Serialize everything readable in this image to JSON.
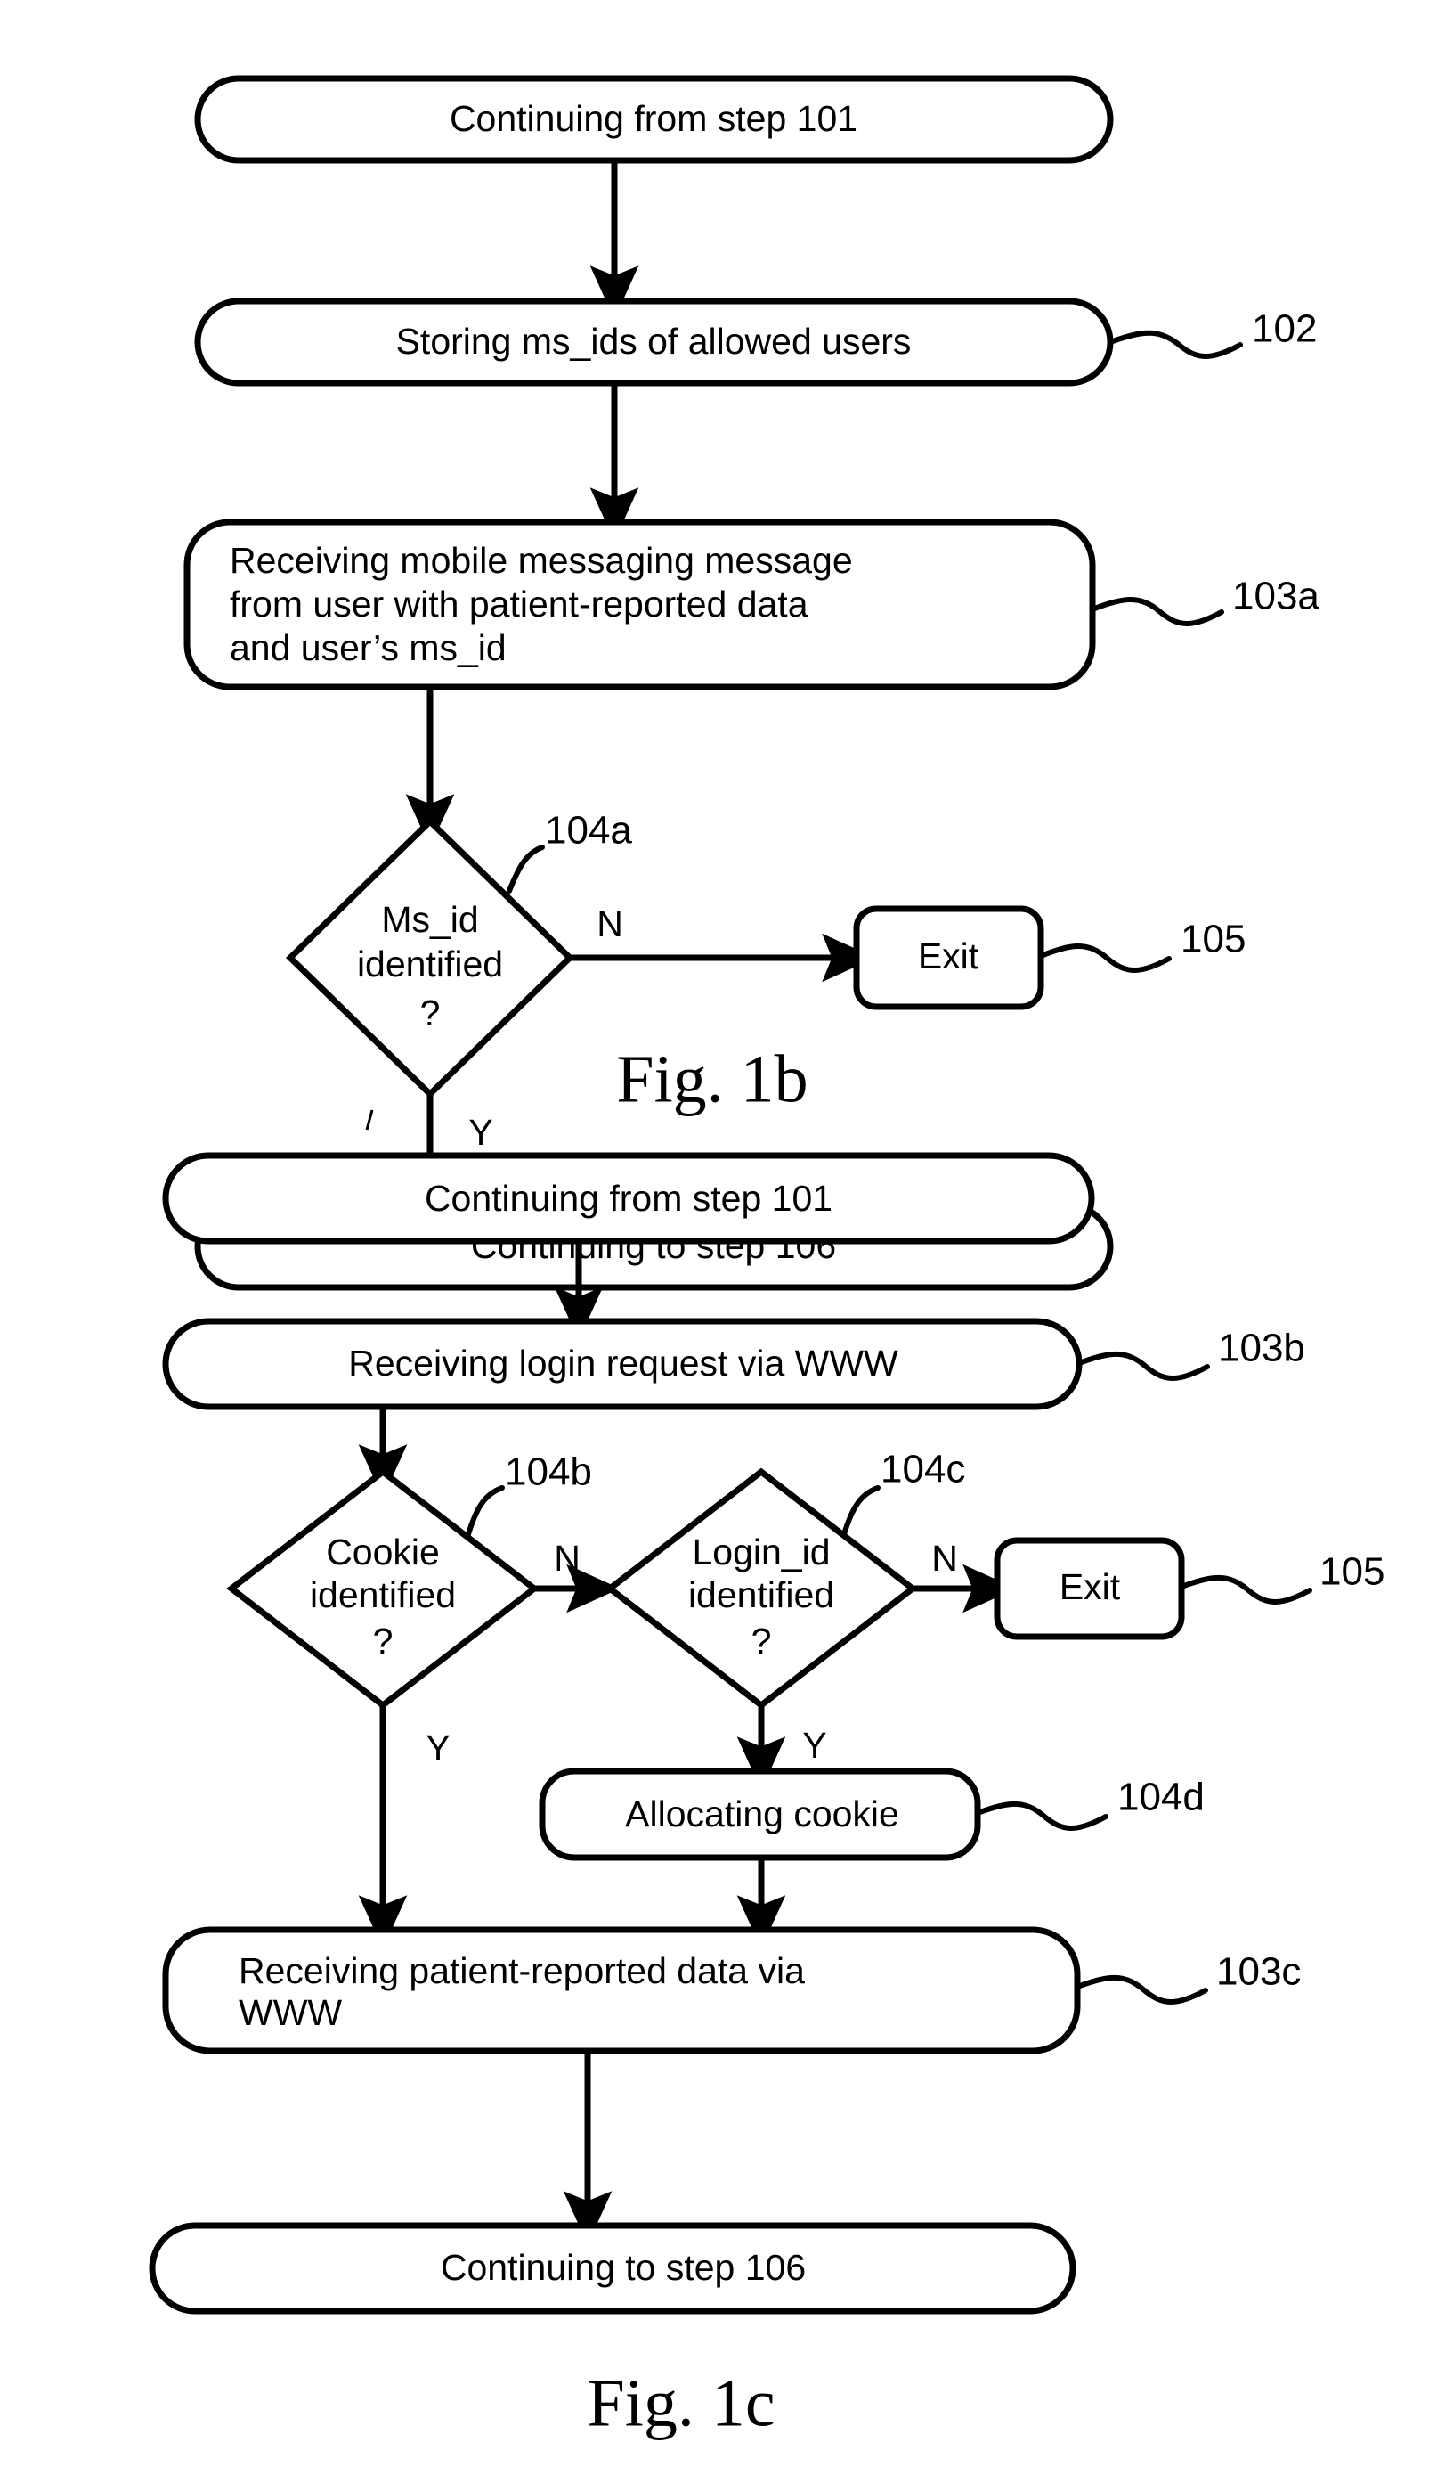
{
  "document": {
    "type": "patent-figure-sheet",
    "background_color": "#ffffff",
    "ink_color": "#000000"
  },
  "figures": [
    {
      "id": "fig-1b",
      "caption": "Fig. 1b",
      "nodes": [
        {
          "id": "fig1b-node-101",
          "shape": "rounded-rectangle",
          "text": "Continuing from step 101",
          "reference": null
        },
        {
          "id": "fig1b-node-102",
          "shape": "rounded-rectangle",
          "text": "Storing ms_ids of allowed users",
          "reference": "102"
        },
        {
          "id": "fig1b-node-103a",
          "shape": "rounded-rectangle",
          "text": "Receiving mobile messaging message from user with patient-reported data and user’s ms_id",
          "text_lines": [
            "Receiving mobile messaging message",
            "from user with patient-reported data",
            "and user’s ms_id"
          ],
          "reference": "103a"
        },
        {
          "id": "fig1b-node-104a",
          "shape": "diamond",
          "text": "Ms_id identified ?",
          "text_lines": [
            "Ms_id",
            "identified",
            "?"
          ],
          "reference": "104a"
        },
        {
          "id": "fig1b-node-105",
          "shape": "rounded-rectangle",
          "text": "Exit",
          "reference": "105"
        },
        {
          "id": "fig1b-node-106",
          "shape": "rounded-rectangle",
          "text": "Continuing to step 106",
          "reference": null
        }
      ],
      "branch_labels": [
        {
          "id": "fig1b-branch-n",
          "text": "N",
          "from": "fig1b-node-104a",
          "to": "fig1b-node-105"
        },
        {
          "id": "fig1b-branch-y",
          "text": "Y",
          "from": "fig1b-node-104a",
          "to": "fig1b-node-106"
        }
      ]
    },
    {
      "id": "fig-1c",
      "caption": "Fig. 1c",
      "nodes": [
        {
          "id": "fig1c-node-101",
          "shape": "rounded-rectangle",
          "text": "Continuing from step 101",
          "reference": null
        },
        {
          "id": "fig1c-node-103b",
          "shape": "rounded-rectangle",
          "text": "Receiving login request via WWW",
          "reference": "103b"
        },
        {
          "id": "fig1c-node-104b",
          "shape": "diamond",
          "text": "Cookie identified ?",
          "text_lines": [
            "Cookie",
            "identified",
            "?"
          ],
          "reference": "104b"
        },
        {
          "id": "fig1c-node-104c",
          "shape": "diamond",
          "text": "Login_id identified ?",
          "text_lines": [
            "Login_id",
            "identified",
            "?"
          ],
          "reference": "104c"
        },
        {
          "id": "fig1c-node-105",
          "shape": "rounded-rectangle",
          "text": "Exit",
          "reference": "105"
        },
        {
          "id": "fig1c-node-104d",
          "shape": "rounded-rectangle",
          "text": "Allocating cookie",
          "reference": "104d"
        },
        {
          "id": "fig1c-node-103c",
          "shape": "rounded-rectangle",
          "text": "Receiving patient-reported data via WWW",
          "text_lines": [
            "Receiving patient-reported data via",
            "WWW"
          ],
          "reference": "103c"
        },
        {
          "id": "fig1c-node-106",
          "shape": "rounded-rectangle",
          "text": "Continuing to step 106",
          "reference": null
        }
      ],
      "branch_labels": [
        {
          "id": "fig1c-branch-104b-n",
          "text": "N",
          "from": "fig1c-node-104b",
          "to": "fig1c-node-104c"
        },
        {
          "id": "fig1c-branch-104b-y",
          "text": "Y",
          "from": "fig1c-node-104b",
          "to": "fig1c-node-103c"
        },
        {
          "id": "fig1c-branch-104c-n",
          "text": "N",
          "from": "fig1c-node-104c",
          "to": "fig1c-node-105"
        },
        {
          "id": "fig1c-branch-104c-y",
          "text": "Y",
          "from": "fig1c-node-104c",
          "to": "fig1c-node-104d"
        }
      ]
    }
  ],
  "text": {
    "fig1b": {
      "box101": "Continuing from step 101",
      "box102": "Storing ms_ids of allowed users",
      "box103a_l1": "Receiving mobile messaging message",
      "box103a_l2": "from user with patient-reported data",
      "box103a_l3": "and user’s ms_id",
      "diamond104a_l1": "Ms_id",
      "diamond104a_l2": "identified",
      "diamond104a_l3": "?",
      "box105": "Exit",
      "box106": "Continuing to step 106",
      "label_n": "N",
      "label_y": "Y",
      "ref102": "102",
      "ref103a": "103a",
      "ref104a": "104a",
      "ref105": "105",
      "caption": "Fig. 1b"
    },
    "fig1c": {
      "box101": "Continuing from step 101",
      "box103b": "Receiving login request via WWW",
      "diamond104b_l1": "Cookie",
      "diamond104b_l2": "identified",
      "diamond104b_l3": "?",
      "diamond104c_l1": "Login_id",
      "diamond104c_l2": "identified",
      "diamond104c_l3": "?",
      "box105": "Exit",
      "box104d": "Allocating cookie",
      "box103c_l1": "Receiving patient-reported data via",
      "box103c_l2": "WWW",
      "box106": "Continuing to step 106",
      "label_104b_n": "N",
      "label_104b_y": "Y",
      "label_104c_n": "N",
      "label_104c_y": "Y",
      "ref103b": "103b",
      "ref104b": "104b",
      "ref104c": "104c",
      "ref105": "105",
      "ref104d": "104d",
      "ref103c": "103c",
      "caption": "Fig. 1c"
    }
  }
}
